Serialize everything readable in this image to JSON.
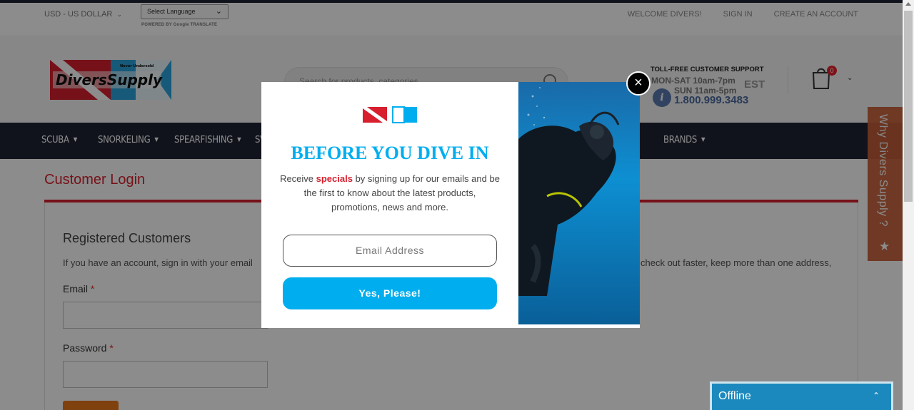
{
  "topbar": {
    "currency": "USD - US DOLLAR",
    "language_select": "Select Language",
    "powered_by": "POWERED BY Google TRANSLATE",
    "links": [
      "WELCOME DIVERS!",
      "SIGN IN",
      "CREATE AN ACCOUNT"
    ]
  },
  "header": {
    "logo_text": "DiversSupply",
    "logo_tagline": "Never Undersold",
    "search_placeholder": "Search for products, categories",
    "support_title": "TOLL-FREE CUSTOMER SUPPORT",
    "support_hours_1": "MON-SAT 10am-7pm",
    "support_hours_2": "SUN 11am-5pm",
    "support_tz": "EST",
    "support_phone": "1.800.999.3483",
    "cart_count": "0"
  },
  "nav": {
    "items": [
      "SCUBA",
      "SNORKELING",
      "SPEARFISHING",
      "SV",
      "BRANDS"
    ]
  },
  "page": {
    "title": "Customer Login",
    "registered_title": "Registered Customers",
    "registered_text": "If you have an account, sign in with your email",
    "registered_text_right": "check out faster, keep more than one address,",
    "email_label": "Email",
    "password_label": "Password",
    "required_mark": "*"
  },
  "side_tab": {
    "label": "Why Divers Supply ?"
  },
  "modal": {
    "title": "BEFORE YOU DIVE IN",
    "text_before": "Receive ",
    "text_highlight": "specials",
    "text_after": " by signing up for our emails and be the first to know about the latest products, promotions, news and more.",
    "email_placeholder": "Email Address",
    "submit_label": "Yes, Please!",
    "close_symbol": "×"
  },
  "chat": {
    "status": "Offline"
  },
  "colors": {
    "brand_red": "#d71f2e",
    "brand_cyan": "#00aeef",
    "nav_bg": "#1f2433",
    "side_tab": "#c9613a",
    "chat_bg": "#1b89bd"
  }
}
